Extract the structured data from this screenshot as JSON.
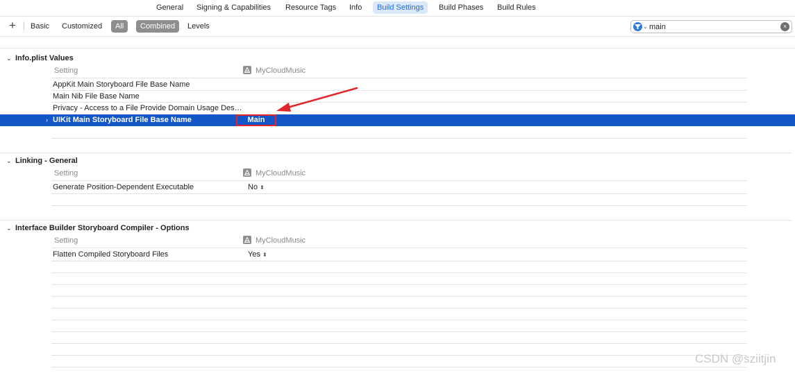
{
  "tabs": [
    "General",
    "Signing & Capabilities",
    "Resource Tags",
    "Info",
    "Build Settings",
    "Build Phases",
    "Build Rules"
  ],
  "active_tab": "Build Settings",
  "filter": {
    "add_label": "+",
    "buttons": [
      "Basic",
      "Customized",
      "All",
      "Combined",
      "Levels"
    ],
    "selected": [
      "All",
      "Combined"
    ],
    "search_value": "main",
    "clear_label": "×"
  },
  "columns": {
    "setting": "Setting",
    "target": "MyCloudMusic"
  },
  "sections": [
    {
      "title": "Info.plist Values",
      "rows": [
        {
          "name": "AppKit Main Storyboard File Base Name",
          "value": ""
        },
        {
          "name": "Main Nib File Base Name",
          "value": ""
        },
        {
          "name": "Privacy - Access to a File Provide Domain Usage Descri...",
          "value": ""
        }
      ],
      "selected_row": {
        "name": "UIKit Main Storyboard File Base Name",
        "value": "Main"
      }
    },
    {
      "title": "Linking - General",
      "rows": [
        {
          "name": "Generate Position-Dependent Executable",
          "value": "No"
        }
      ]
    },
    {
      "title": "Interface Builder Storyboard Compiler - Options",
      "rows": [
        {
          "name": "Flatten Compiled Storyboard Files",
          "value": "Yes"
        }
      ]
    }
  ],
  "icons": {
    "disclosure_open": "chevron-down-icon",
    "disclosure_closed": "chevron-right-icon",
    "stepper": "up-down-stepper-icon",
    "target": "app-target-icon"
  },
  "colors": {
    "accent": "#1a6fdc",
    "selection": "#1456c8",
    "annotation": "#e0262b"
  },
  "watermark": "CSDN @sziitjin"
}
